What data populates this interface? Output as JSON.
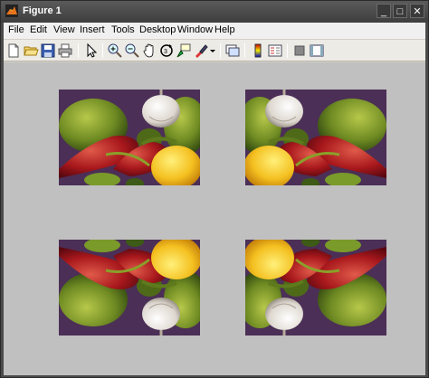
{
  "window": {
    "title": "Figure 1",
    "controls": {
      "minimize": "_",
      "maximize": "□",
      "close": "✕"
    }
  },
  "menubar": {
    "items": [
      "File",
      "Edit",
      "View",
      "Insert",
      "Tools",
      "Desktop",
      "Window",
      "Help"
    ]
  },
  "toolbar": {
    "tools": [
      "new-figure-icon",
      "open-file-icon",
      "save-icon",
      "print-icon",
      "edit-plot-icon",
      "zoom-in-icon",
      "zoom-out-icon",
      "pan-icon",
      "rotate-3d-icon",
      "data-cursor-icon",
      "brush-icon",
      "brush-dropdown-icon",
      "link-plot-icon",
      "insert-colorbar-icon",
      "insert-legend-icon",
      "hide-plot-tools-icon",
      "show-plot-tools-icon"
    ]
  },
  "figure": {
    "background": "#c0c0c0",
    "panels": [
      {
        "name": "original",
        "flip": "none"
      },
      {
        "name": "flipped-horizontal",
        "flip": "horizontal"
      },
      {
        "name": "flipped-vertical",
        "flip": "vertical"
      },
      {
        "name": "flipped-both",
        "flip": "both"
      }
    ]
  }
}
